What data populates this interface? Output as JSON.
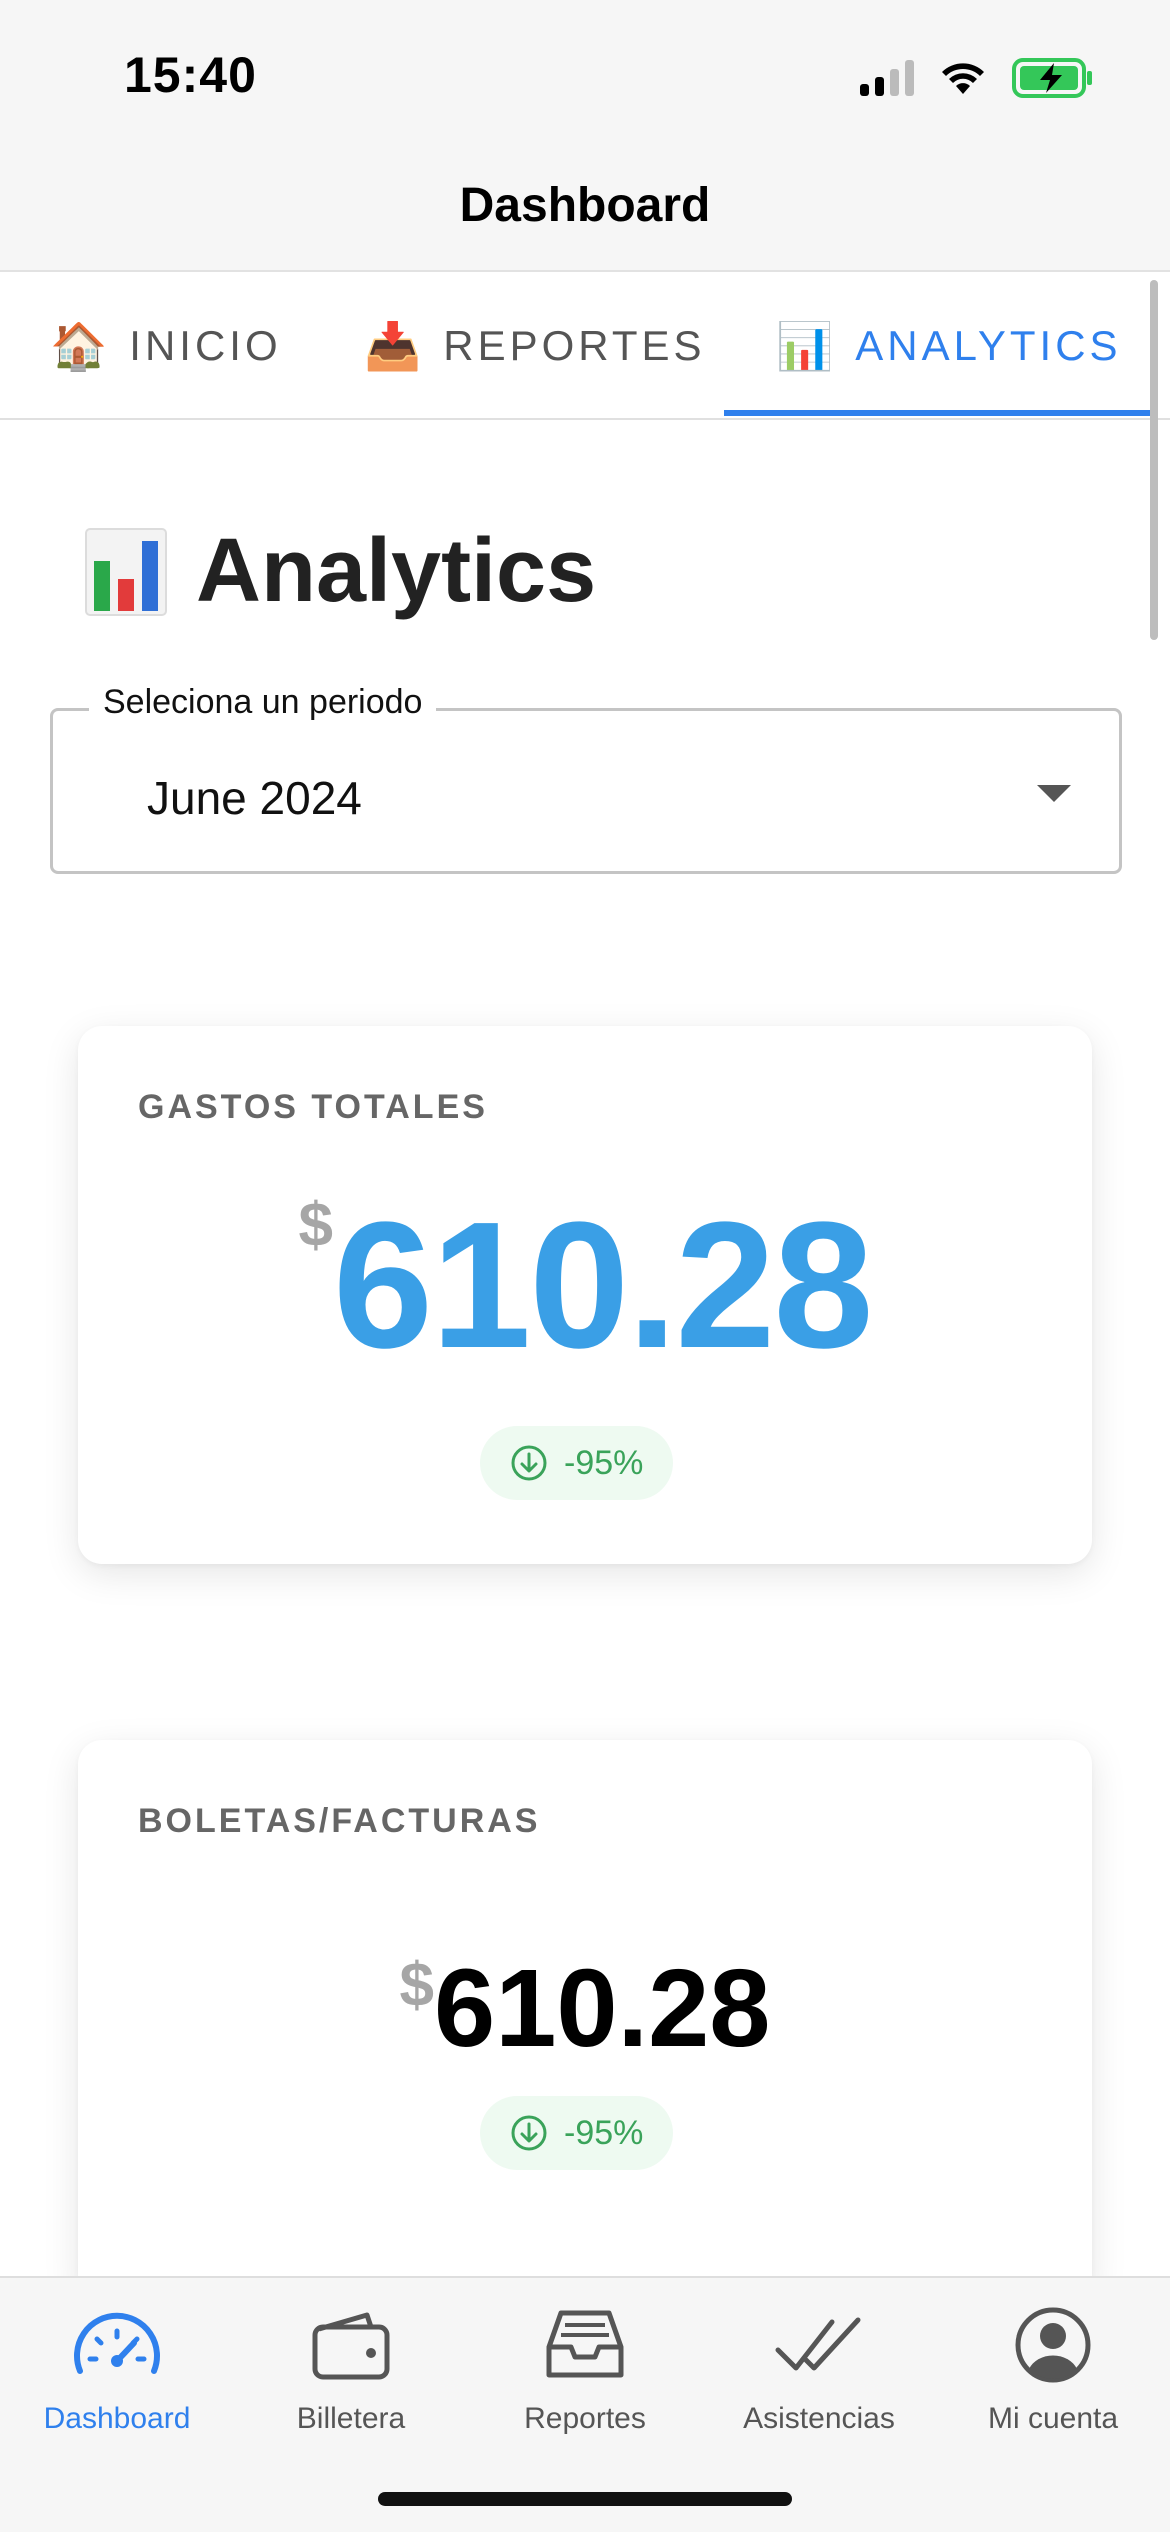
{
  "status_bar": {
    "time": "15:40"
  },
  "nav": {
    "title": "Dashboard"
  },
  "tabs": [
    {
      "emoji": "🏠",
      "label": "INICIO",
      "active": false
    },
    {
      "emoji": "📥",
      "label": "REPORTES",
      "active": false
    },
    {
      "emoji": "📊",
      "label": "ANALYTICS",
      "active": true
    }
  ],
  "page": {
    "heading_emoji": "📊",
    "heading": "Analytics"
  },
  "period_select": {
    "label": "Seleciona un periodo",
    "value": "June 2024"
  },
  "cards": [
    {
      "label": "GASTOS TOTALES",
      "currency": "$",
      "amount": "610.28",
      "change": "-95%"
    },
    {
      "label": "BOLETAS/FACTURAS",
      "currency": "$",
      "amount": "610.28",
      "change": "-95%"
    }
  ],
  "bottom_tabs": [
    {
      "label": "Dashboard",
      "icon": "speedometer-icon",
      "active": true
    },
    {
      "label": "Billetera",
      "icon": "wallet-icon",
      "active": false
    },
    {
      "label": "Reportes",
      "icon": "inbox-tray-icon",
      "active": false
    },
    {
      "label": "Asistencias",
      "icon": "double-check-icon",
      "active": false
    },
    {
      "label": "Mi cuenta",
      "icon": "user-circle-icon",
      "active": false
    }
  ],
  "colors": {
    "accent": "#2f80ed",
    "amount_blue": "#3a9fe6",
    "positive_green": "#3aa35a",
    "battery_green": "#34c759"
  }
}
